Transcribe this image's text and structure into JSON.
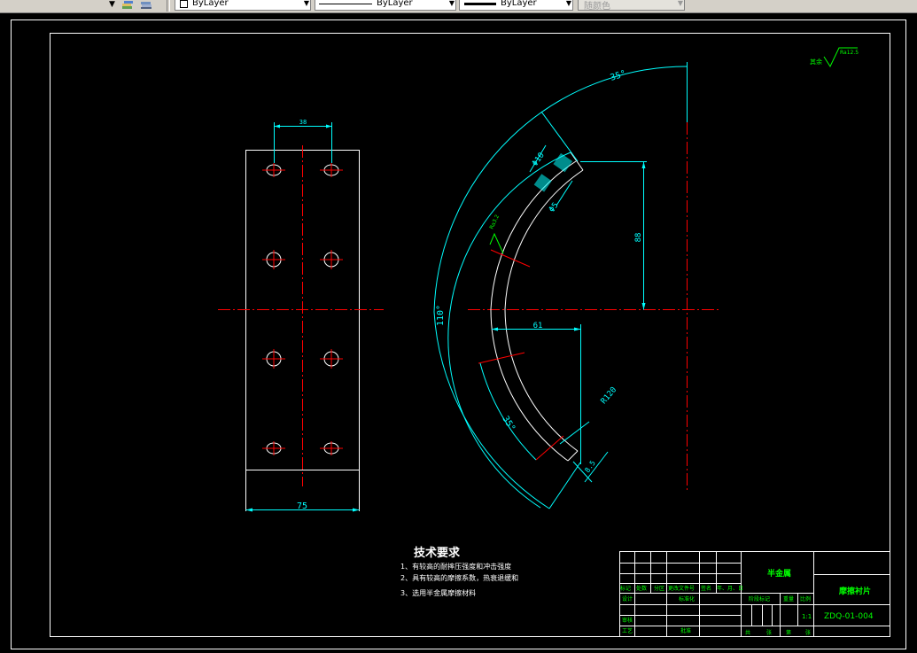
{
  "toolbar": {
    "layer_color_value": "ByLayer",
    "linetype_value": "ByLayer",
    "lineweight_value": "ByLayer",
    "plot_style_value": "随颜色"
  },
  "drawing": {
    "dimensions": {
      "hole_spacing": "38",
      "overall_width": "75",
      "outer_arc_angle": "35°",
      "hole_diameter": "Φ10",
      "hole_offset": "Φ5",
      "vertical_offset": "88",
      "horizontal_offset": "61",
      "radius": "R120",
      "inner_arc_angle": "35°",
      "total_angle": "110°",
      "thickness": "8.5",
      "surface_roughness_leader": "Ra3.2"
    },
    "roughness_note": {
      "prefix": "其余",
      "value": "Ra12.5"
    },
    "technical_requirements": {
      "heading": "技术要求",
      "items": [
        "1、有较高的耐摔压强度和冲击强度",
        "2、具有较高的摩擦系数，热衰退缓和",
        "3、选用半金属摩擦材料"
      ]
    },
    "title_block": {
      "material": "半金属",
      "part_name": "摩擦衬片",
      "drawing_number": "ZDQ-01-004",
      "scale": "1:1",
      "row_labels": [
        "标记",
        "处数",
        "分区",
        "更改文件号",
        "签名",
        "年、月、日"
      ],
      "design_label": "设计",
      "standardization_label": "标准化",
      "review_label": "审核",
      "process_label": "工艺",
      "approve_label": "批准",
      "stage_mark_label": "阶段标记",
      "weight_label": "重量",
      "scale_label": "比例",
      "sheet_labels": [
        "共",
        "张",
        "第",
        "张"
      ]
    }
  }
}
